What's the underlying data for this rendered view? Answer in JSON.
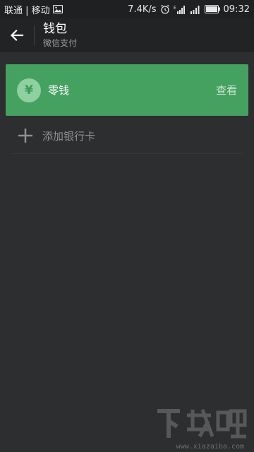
{
  "status_bar": {
    "carrier": "联通 | 移动",
    "speed": "7.4K/s",
    "time": "09:32",
    "icons": [
      "image-icon",
      "alarm-icon",
      "signal-icon",
      "signal-icon",
      "battery-icon"
    ]
  },
  "header": {
    "title": "钱包",
    "subtitle": "微信支付",
    "back_icon": "arrow-left-icon"
  },
  "balance": {
    "icon_symbol": "¥",
    "label": "零钱",
    "action": "查看"
  },
  "add_bank_card": {
    "label": "添加银行卡",
    "icon": "plus-icon"
  },
  "watermark": {
    "logo_text": "下载吧",
    "url": "www.xiazaiba.com"
  },
  "colors": {
    "background": "#2c2e2f",
    "app_bar": "#222324",
    "card_green": "#45a160",
    "text_primary": "#ffffff",
    "text_muted": "#8e9093"
  }
}
